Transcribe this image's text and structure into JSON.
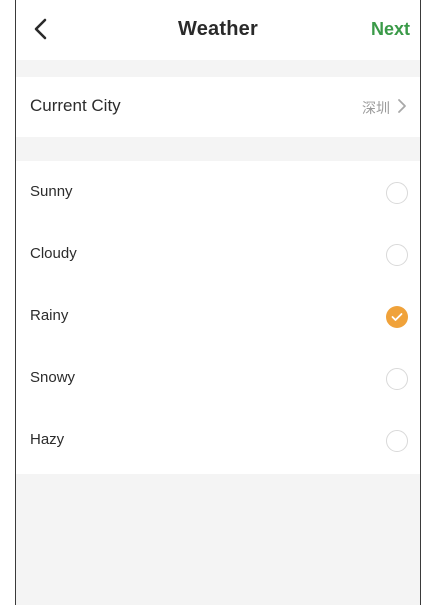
{
  "header": {
    "title": "Weather",
    "next_label": "Next"
  },
  "city_row": {
    "label": "Current City",
    "value": "深圳"
  },
  "options": [
    {
      "label": "Sunny",
      "selected": false
    },
    {
      "label": "Cloudy",
      "selected": false
    },
    {
      "label": "Rainy",
      "selected": true
    },
    {
      "label": "Snowy",
      "selected": false
    },
    {
      "label": "Hazy",
      "selected": false
    }
  ],
  "colors": {
    "accent_green": "#3a9a48",
    "selected_orange": "#f0a23a",
    "background_gray": "#f4f4f4"
  },
  "icons": {
    "back": "chevron-left-icon",
    "city_arrow": "chevron-right-icon",
    "selected": "checkmark-icon"
  }
}
